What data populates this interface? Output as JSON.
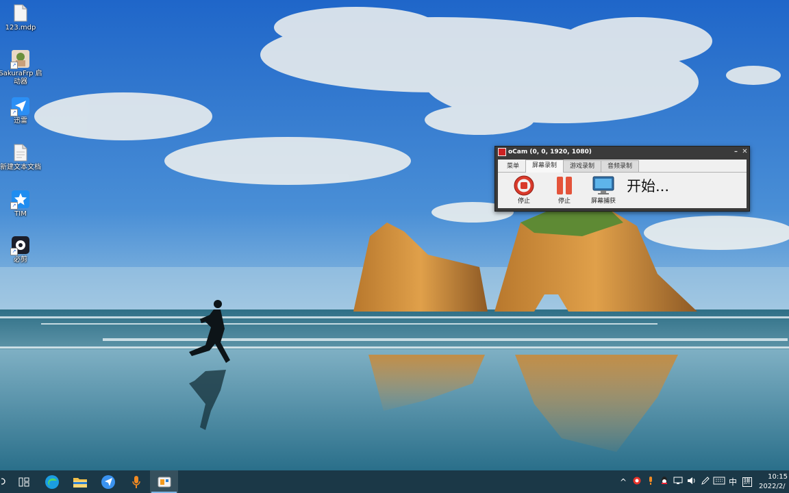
{
  "desktop": {
    "icons": [
      {
        "label": "123.mdp",
        "icon": "document-icon"
      },
      {
        "label": "SakuraFrp 启动器",
        "icon": "sakurafrp-icon"
      },
      {
        "label": "迅雷",
        "icon": "xunlei-icon"
      },
      {
        "label": "新建文本文档",
        "icon": "text-document-icon"
      },
      {
        "label": "TIM",
        "icon": "tim-icon"
      },
      {
        "label": "必剪",
        "icon": "bijian-icon"
      }
    ]
  },
  "ocam": {
    "title": "oCam (0, 0, 1920, 1080)",
    "minimize": "–",
    "close": "✕",
    "tabs": [
      "菜单",
      "屏幕录制",
      "游戏录制",
      "音频录制"
    ],
    "active_tab": "屏幕录制",
    "tools": {
      "record_label": "停止",
      "pause_label": "停止",
      "capture_label": "屏幕捕获"
    },
    "status": "开始..."
  },
  "taskbar": {
    "apps": [
      "task-view-icon",
      "edge-icon",
      "file-explorer-icon",
      "xunlei-icon",
      "microphone-icon",
      "ocam-icon"
    ],
    "tray": {
      "ime_lang": "中",
      "ime_mode": "拼",
      "time": "10:15",
      "date": "2022/2/"
    }
  },
  "colors": {
    "taskbar": "#1b3847",
    "record_red": "#d93a2b",
    "accent": "#7fb6e6"
  }
}
